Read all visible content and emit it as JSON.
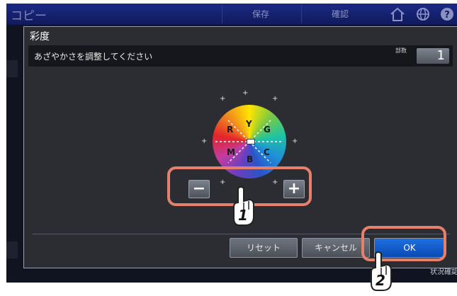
{
  "topbar": {
    "app_title": "コピー",
    "save_label": "保存",
    "confirm_label": "確認"
  },
  "dialog": {
    "title": "彩度",
    "message": "あざやかさを調整してください",
    "copies_label": "部数",
    "copies_value": "1",
    "wheel_labels": {
      "r": "R",
      "y": "Y",
      "g": "G",
      "m": "M",
      "b": "B",
      "c": "C"
    },
    "minus_label": "−",
    "plus_label": "+",
    "reset_label": "リセット",
    "cancel_label": "キャンセル",
    "ok_label": "OK"
  },
  "background": {
    "status_label": "状況確認"
  },
  "callouts": {
    "step1": "1",
    "step2": "2"
  },
  "colors": {
    "highlight": "#e6806a",
    "ok_button": "#0a4ab4",
    "topbar": "#1c2a86"
  }
}
